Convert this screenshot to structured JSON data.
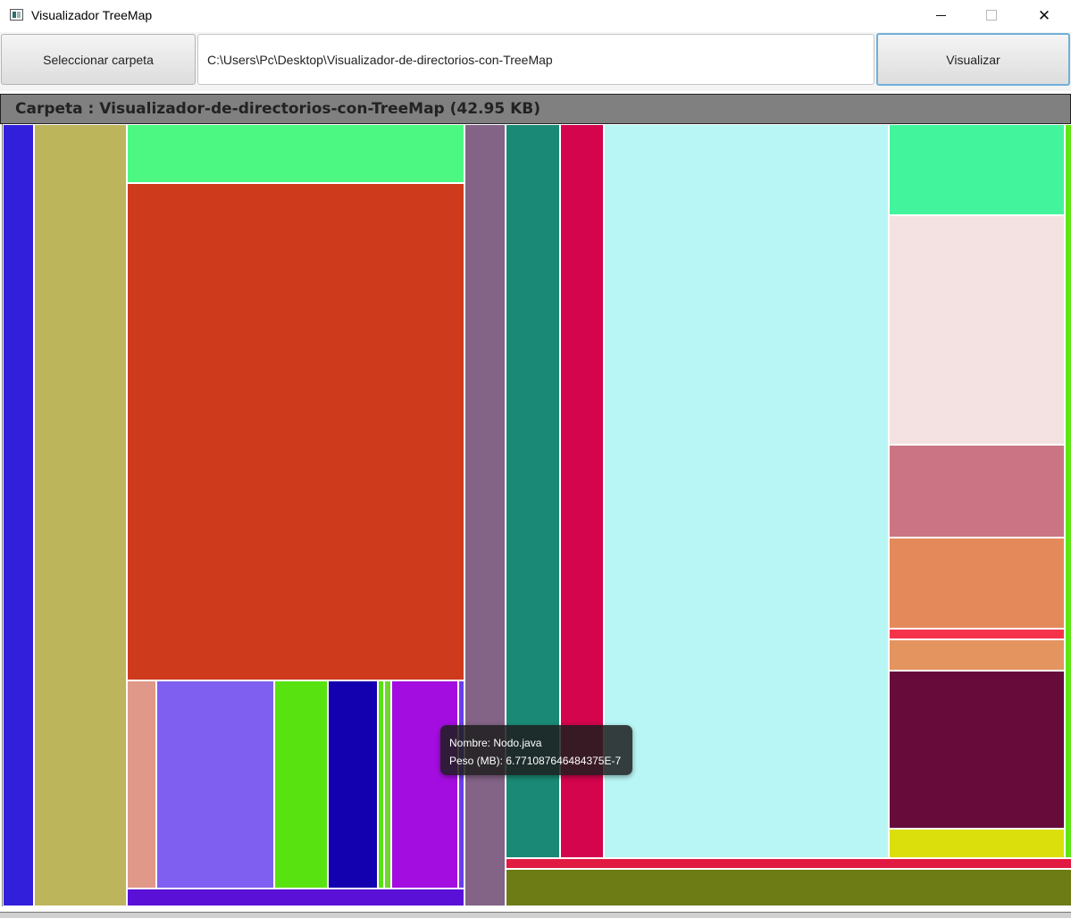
{
  "window": {
    "title": "Visualizador TreeMap",
    "icons": [
      "app-icon",
      "minimize-icon",
      "maximize-icon",
      "close-icon"
    ]
  },
  "toolbar": {
    "select_label": "Seleccionar carpeta",
    "path_value": "C:\\Users\\Pc\\Desktop\\Visualizador-de-directorios-con-TreeMap",
    "visualize_label": "Visualizar"
  },
  "header": {
    "folder_title": "Carpeta : Visualizador-de-directorios-con-TreeMap (42.95 KB)"
  },
  "tooltip": {
    "name_line": "Nombre: Nodo.java",
    "size_line": "Peso (MB): 6.771087646484375E-7"
  },
  "colors": {
    "header_bg": "#808080",
    "accent_button_border": "#6fb0dc",
    "treemap_blocks": [
      "#321fdb",
      "#bdb55b",
      "#4cf882",
      "#ce3b1c",
      "#e09888",
      "#7f5ff0",
      "#58e310",
      "#1300ae",
      "#a40ddf",
      "#5b10d8",
      "#836386",
      "#1a8a76",
      "#d4044d",
      "#b8f6f5",
      "#42f49c",
      "#f4e2e2",
      "#cb7584",
      "#e48a5a",
      "#f5344b",
      "#e4945f",
      "#660b3a",
      "#dbe00c",
      "#e11a41",
      "#6e7c16"
    ]
  }
}
